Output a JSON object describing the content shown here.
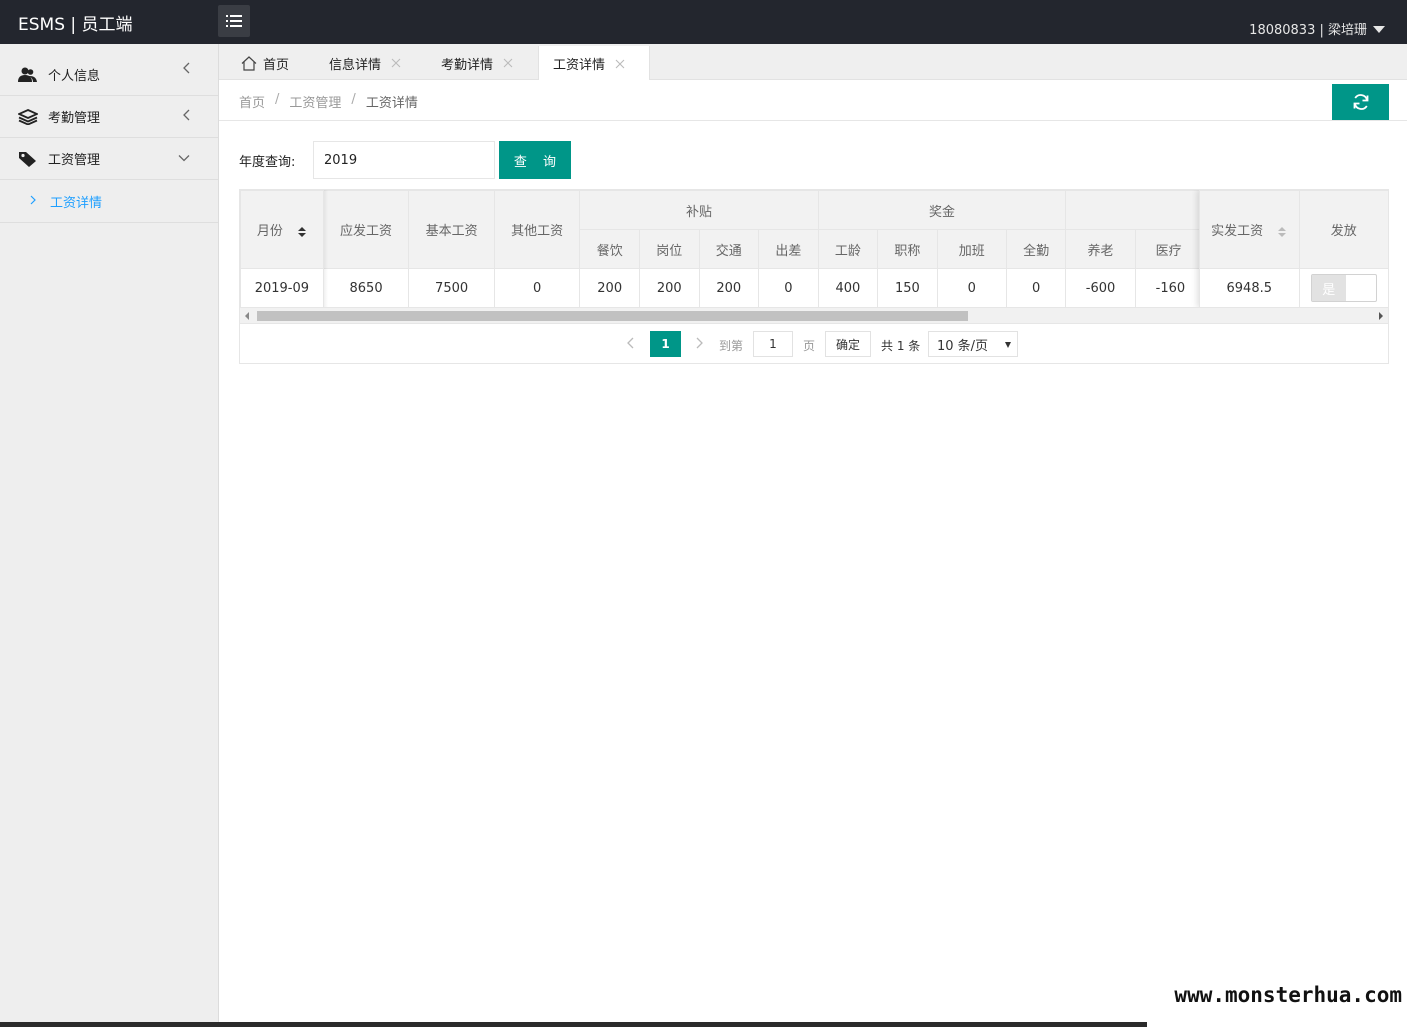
{
  "header": {
    "logo": "ESMS | 员工端",
    "user": "18080833 | 梁培珊"
  },
  "sidebar": {
    "items": [
      {
        "label": "个人信息",
        "icon": "users-icon"
      },
      {
        "label": "考勤管理",
        "icon": "layers-icon"
      },
      {
        "label": "工资管理",
        "icon": "tag-icon"
      }
    ],
    "sub_item": "工资详情"
  },
  "tabs": [
    {
      "label": "首页"
    },
    {
      "label": "信息详情"
    },
    {
      "label": "考勤详情"
    },
    {
      "label": "工资详情"
    }
  ],
  "breadcrumb": {
    "home": "首页",
    "section": "工资管理",
    "current": "工资详情",
    "sep": "/"
  },
  "query": {
    "label": "年度查询:",
    "value": "2019",
    "button": "查 询"
  },
  "table": {
    "group_headers": {
      "subsidy": "补贴",
      "bonus": "奖金"
    },
    "columns": {
      "month": "月份",
      "gross": "应发工资",
      "base": "基本工资",
      "other": "其他工资",
      "meal": "餐饮",
      "post": "岗位",
      "traffic": "交通",
      "travel": "出差",
      "seniority": "工龄",
      "title": "职称",
      "overtime": "加班",
      "attendance": "全勤",
      "pension": "养老",
      "medical": "医疗",
      "net": "实发工资",
      "issued": "发放"
    },
    "row": {
      "month": "2019-09",
      "gross": "8650",
      "base": "7500",
      "other": "0",
      "meal": "200",
      "post": "200",
      "traffic": "200",
      "travel": "0",
      "seniority": "400",
      "title": "150",
      "overtime": "0",
      "attendance": "0",
      "pension": "-600",
      "medical": "-160",
      "net": "6948.5",
      "issued": "是"
    }
  },
  "pager": {
    "current": "1",
    "goto": "到第",
    "page_input": "1",
    "page_unit": "页",
    "confirm": "确定",
    "total": "共 1 条",
    "per_page": "10 条/页"
  },
  "watermark": "www.monsterhua.com",
  "colors": {
    "accent": "#009688",
    "header": "#23262e",
    "link": "#1e9fff"
  }
}
